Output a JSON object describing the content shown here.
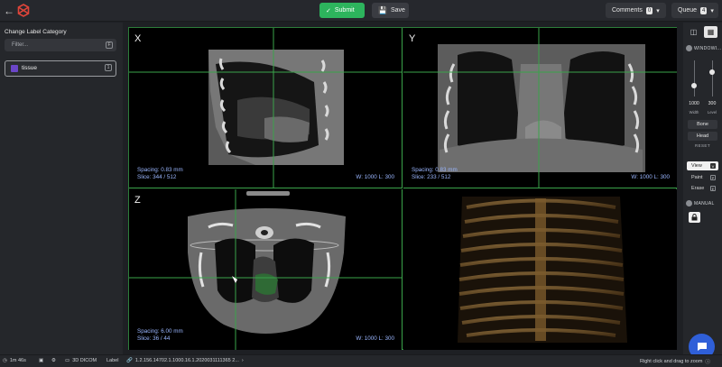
{
  "header": {
    "submit_label": "Submit",
    "save_label": "Save",
    "comments_label": "Comments",
    "comments_count": "0",
    "queue_label": "Queue",
    "queue_count": "4"
  },
  "left_panel": {
    "title": "Change Label Category",
    "filter_placeholder": "Filter...",
    "filter_shortcut": "F",
    "labels": [
      {
        "name": "tissue",
        "shortcut": "1",
        "color": "#6b46c8"
      }
    ]
  },
  "viewports": {
    "x": {
      "letter": "X",
      "spacing": "Spacing: 0.83 mm",
      "slice": "Slice: 344 / 512",
      "window": "W: 1000 L: 300"
    },
    "y": {
      "letter": "Y",
      "spacing": "Spacing: 0.83 mm",
      "slice": "Slice: 233 / 512",
      "window": "W: 1000 L: 300"
    },
    "z": {
      "letter": "Z",
      "spacing": "Spacing: 6.00 mm",
      "slice": "Slice: 36 / 44",
      "window": "W: 1000 L: 300"
    }
  },
  "right_panel": {
    "windowing_label": "WINDOWI...",
    "width_value": "1000",
    "width_label": "Width",
    "level_value": "300",
    "level_label": "Level",
    "presets": [
      "Bone",
      "Head"
    ],
    "reset_label": "RESET",
    "tools": [
      {
        "label": "View",
        "key": "V"
      },
      {
        "label": "Paint",
        "key": "P"
      },
      {
        "label": "Erase",
        "key": "E"
      }
    ],
    "manual_label": "MANUAL"
  },
  "footer": {
    "timer": "1m 46s",
    "format": "3D DICOM",
    "mode": "Label",
    "series_uid": "1.2.156.14702.1.1000.16.1.2020031111365 2...",
    "hint": "Right click and drag to zoom"
  },
  "colors": {
    "accent_green": "#2db45d",
    "label_purple": "#6b46c8",
    "chat_blue": "#2f5fd8",
    "crosshair": "#3aa34a"
  }
}
